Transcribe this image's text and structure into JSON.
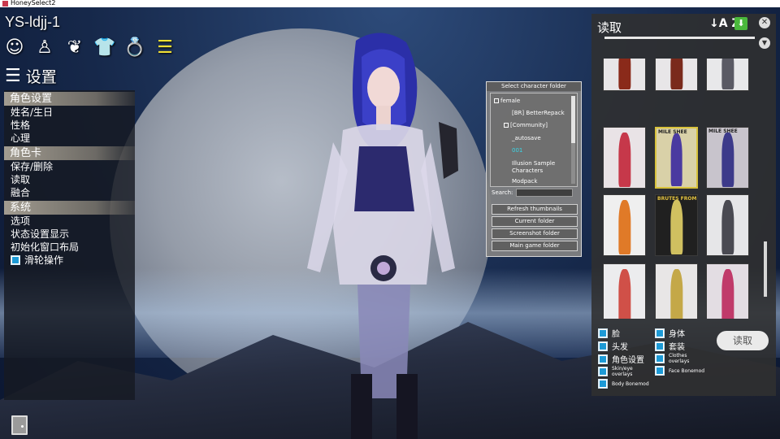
{
  "window": {
    "title": "HoneySelect2"
  },
  "character_name": "YS-ldjj-1",
  "top_icons": [
    {
      "name": "face-icon",
      "glyph": "☺"
    },
    {
      "name": "body-icon",
      "glyph": "♙"
    },
    {
      "name": "hair-icon",
      "glyph": "❦"
    },
    {
      "name": "clothes-icon",
      "glyph": "👕"
    },
    {
      "name": "accessory-icon",
      "glyph": "💍"
    },
    {
      "name": "settings-list-icon",
      "glyph": "☰"
    }
  ],
  "settings_header": {
    "label": "设置"
  },
  "left_menu": {
    "section1": {
      "title": "角色设置",
      "items": [
        "姓名/生日",
        "性格",
        "心理"
      ]
    },
    "section2": {
      "title": "角色卡",
      "items": [
        "保存/删除",
        "读取",
        "融合"
      ]
    },
    "section3": {
      "title": "系统",
      "items": [
        "选项",
        "状态设置显示",
        "初始化窗口布局"
      ],
      "toggle_label": "滑轮操作"
    }
  },
  "folder_dialog": {
    "title": "Select character folder",
    "tree": [
      "female",
      "[BR] BetterRepack",
      "[Community]",
      "_autosave",
      "001",
      "Illusion Sample Characters",
      "Modpack"
    ],
    "search_label": "Search:",
    "search_value": "",
    "buttons": [
      "Refresh thumbnails",
      "Current folder",
      "Screenshot folder",
      "Main game folder"
    ]
  },
  "load_panel": {
    "title": "读取",
    "sort_glyph": "↓A Z",
    "save_glyph": "⬇",
    "close_glyph": "✕",
    "dropdown_glyph": "▼",
    "cards": [
      {
        "bg": "#e8e6e8",
        "fig": "#8a2a1a"
      },
      {
        "bg": "#e8e6e8",
        "fig": "#7a2a1c"
      },
      {
        "bg": "#e8e8ea",
        "fig": "#5a5a64"
      },
      {
        "bg": "#e9e3e6",
        "fig": "#c6384a"
      },
      {
        "bg": "#d9d1a8",
        "fig": "#4a3aa0",
        "text": "MILE SHEE"
      },
      {
        "bg": "#c8c4cc",
        "fig": "#3c3a8a",
        "text": "MILE SHEE"
      },
      {
        "bg": "#efefef",
        "fig": "#e07a28"
      },
      {
        "bg": "#202020",
        "fig": "#d0c060",
        "text": "BRUTES FROM THE"
      },
      {
        "bg": "#e6e6e8",
        "fig": "#4a4a52"
      },
      {
        "bg": "#ececee",
        "fig": "#d05048"
      },
      {
        "bg": "#e8e6e6",
        "fig": "#c4a848"
      },
      {
        "bg": "#e3dde3",
        "fig": "#c03a6a"
      }
    ],
    "filters": [
      {
        "label": "脸"
      },
      {
        "label": "身体"
      },
      {
        "label": "头发"
      },
      {
        "label": "套装"
      },
      {
        "label": "角色设置"
      },
      {
        "label": "Clothes overlays"
      },
      {
        "label": "Skin/eye overlays"
      },
      {
        "label": "Face Bonemod"
      },
      {
        "label": "Body Bonemod"
      }
    ],
    "load_button": "读取"
  }
}
